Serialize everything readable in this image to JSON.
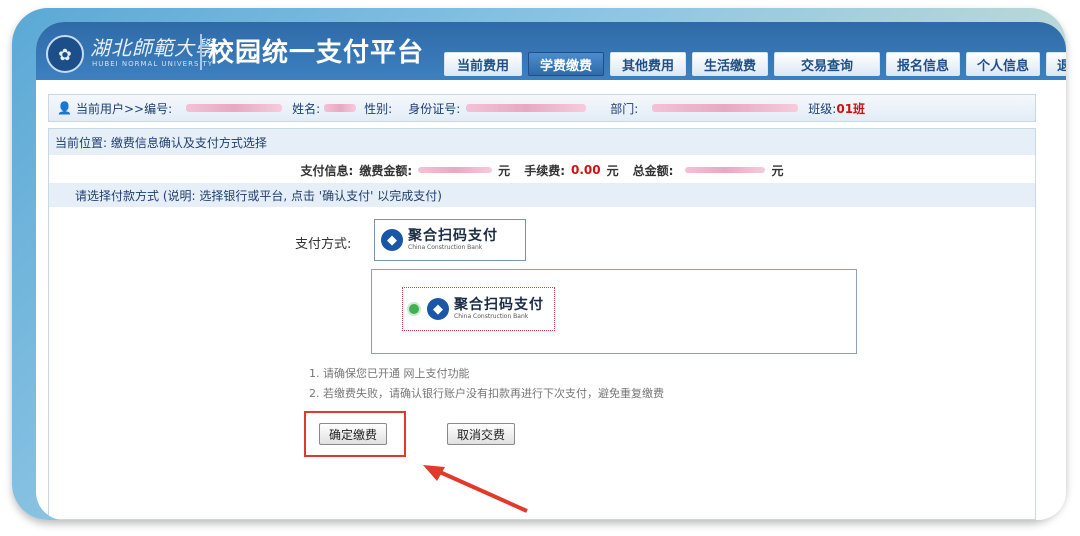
{
  "header": {
    "university_name": "湖北師範大學",
    "university_en": "HUBEI NORMAL UNIVERSITY",
    "platform_title": "校园统一支付平台",
    "nav": [
      {
        "label": "当前费用",
        "active": false
      },
      {
        "label": "学费缴费",
        "active": true
      },
      {
        "label": "其他费用",
        "active": false
      },
      {
        "label": "生活缴费",
        "active": false
      },
      {
        "label": "交易查询",
        "active": false
      },
      {
        "label": "报名信息",
        "active": false
      },
      {
        "label": "个人信息",
        "active": false
      },
      {
        "label": "退出登录",
        "active": false
      }
    ]
  },
  "userbar": {
    "current_user": "当前用户>>编号:",
    "name_label": "姓名:",
    "gender_label": "性别:",
    "id_label": "身份证号:",
    "dept_label": "部门:",
    "class_label": "班级:",
    "class_value": "01班"
  },
  "content": {
    "location": "当前位置: 缴费信息确认及支付方式选择",
    "payinfo": {
      "label": "支付信息:",
      "amount_label": "缴费金额:",
      "unit1": "元",
      "fee_label": "手续费:",
      "fee_value": "0.00",
      "unit2": "元",
      "total_label": "总金额:",
      "unit3": "元"
    },
    "choose_text": "请选择付款方式 (说明: 选择银行或平台, 点击 '确认支付' 以完成支付)",
    "pay_method_label": "支付方式:",
    "bank": {
      "name_cn": "聚合扫码支付",
      "name_en": "China Construction Bank"
    },
    "notes": [
      "1. 请确保您已开通 网上支付功能",
      "2. 若缴费失败，请确认银行账户没有扣款再进行下次支付，避免重复缴费"
    ],
    "confirm_button": "确定缴费",
    "cancel_button": "取消交费"
  },
  "colors": {
    "header_blue": "#2f6aa8",
    "accent_red": "#e23a2a",
    "class_red": "#d01010"
  }
}
